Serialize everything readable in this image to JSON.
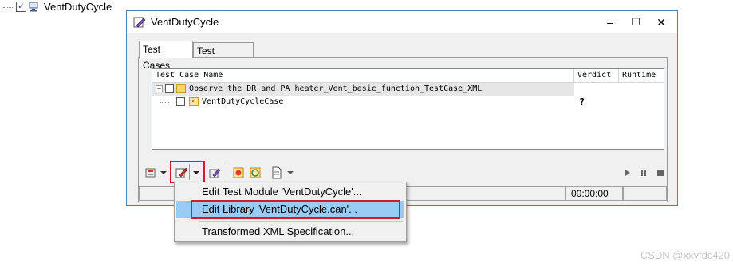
{
  "tree": {
    "root_label": "VentDutyCycle"
  },
  "window": {
    "title": "VentDutyCycle",
    "buttons": {
      "minimize": "–",
      "maximize": "☐",
      "close": "✕"
    }
  },
  "tabs": [
    {
      "label": "Test Cases",
      "active": true
    },
    {
      "label": "Test Observer",
      "active": false
    }
  ],
  "table": {
    "columns": [
      "Test Case Name",
      "Verdict",
      "Runtime"
    ],
    "rows": [
      {
        "name": "Observe the DR and PA heater_Vent_basic_function_TestCase_XML",
        "verdict": "",
        "runtime": ""
      },
      {
        "name": "VentDutyCycleCase",
        "verdict": "?",
        "runtime": ""
      }
    ]
  },
  "status": {
    "time": "00:00:00"
  },
  "menu": {
    "items": [
      {
        "label": "Edit Test Module 'VentDutyCycle'...",
        "selected": false
      },
      {
        "label": "Edit Library 'VentDutyCycle.can'...",
        "selected": true
      },
      {
        "label": "Transformed XML Specification...",
        "selected": false
      }
    ]
  },
  "watermark": "CSDN @xxyfdc420",
  "colors": {
    "highlight_border": "#d21c2a",
    "menu_selected": "#99ccf4",
    "window_border": "#5a7fb5"
  }
}
